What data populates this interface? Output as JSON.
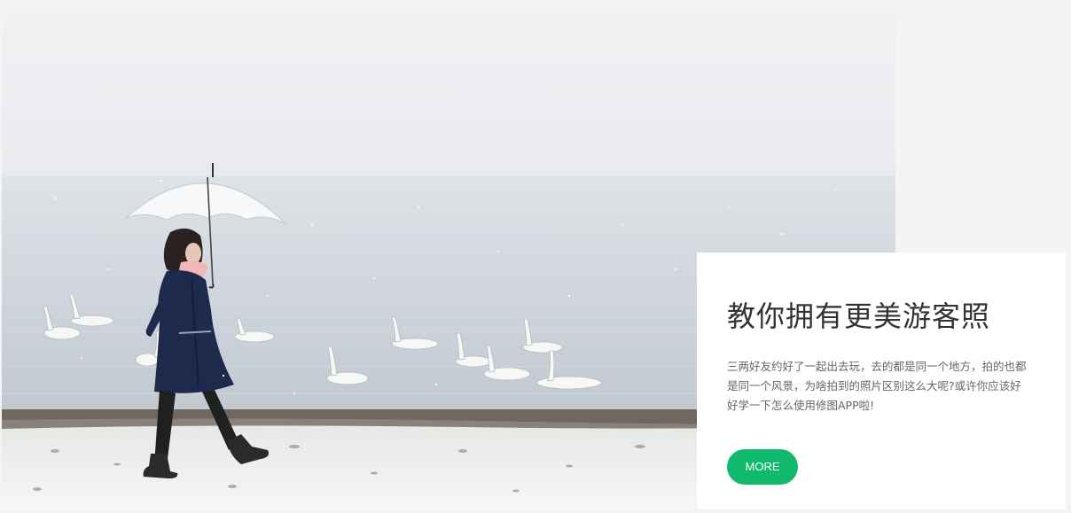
{
  "banner": {
    "title": "教你拥有更美游客照",
    "description": "三两好友约好了一起出去玩，去的都是同一个地方，拍的也都是同一个风景，为啥拍到的照片区别这么大呢?或许你应该好好学一下怎么使用修图APP啦!",
    "more_label": "MORE"
  },
  "colors": {
    "accent": "#10b96b",
    "page_background": "#f4f4f4",
    "card_background": "#ffffff",
    "title": "#333333",
    "body_text": "#666666"
  },
  "icons": {
    "photo": "winter-lake-swans-woman-umbrella-photo"
  }
}
